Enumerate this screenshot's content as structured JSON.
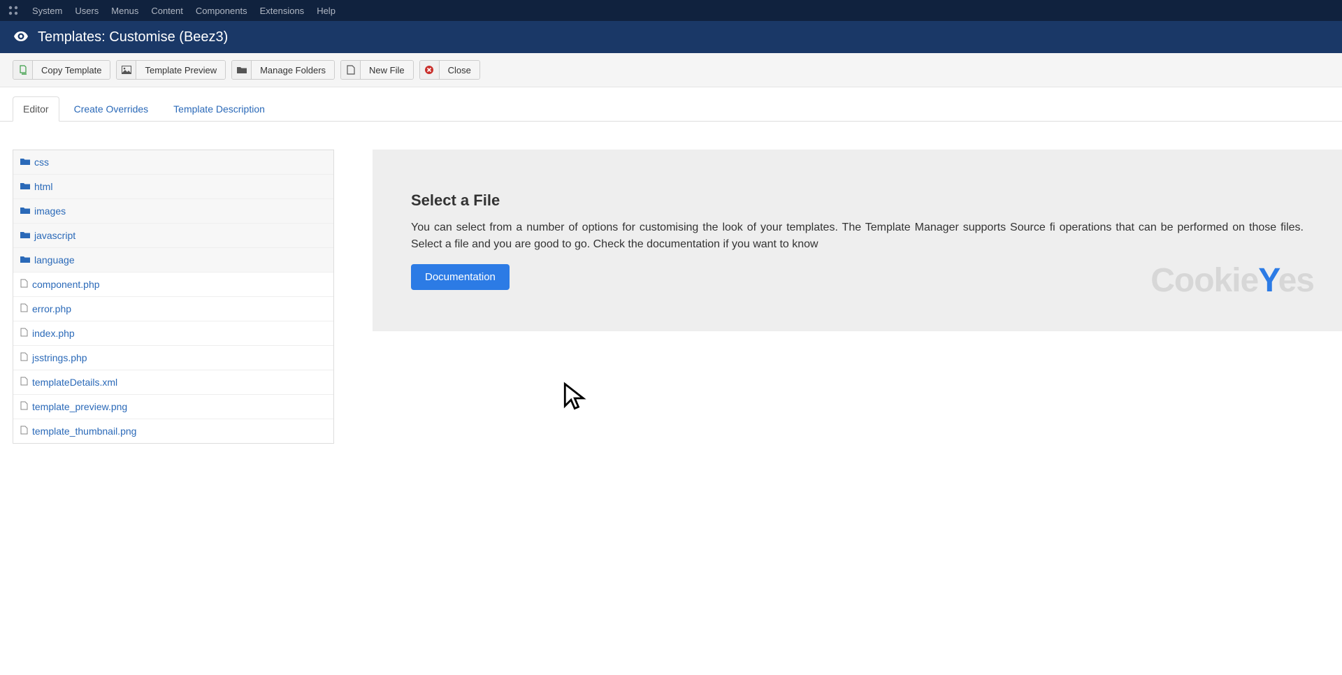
{
  "topnav": {
    "items": [
      "System",
      "Users",
      "Menus",
      "Content",
      "Components",
      "Extensions",
      "Help"
    ]
  },
  "titlebar": {
    "title": "Templates: Customise (Beez3)"
  },
  "toolbar": {
    "copy": "Copy Template",
    "preview": "Template Preview",
    "folders": "Manage Folders",
    "newfile": "New File",
    "close": "Close"
  },
  "tabs": {
    "editor": "Editor",
    "overrides": "Create Overrides",
    "description": "Template Description"
  },
  "filetree": {
    "folders": [
      "css",
      "html",
      "images",
      "javascript",
      "language"
    ],
    "files": [
      "component.php",
      "error.php",
      "index.php",
      "jsstrings.php",
      "templateDetails.xml",
      "template_preview.png",
      "template_thumbnail.png"
    ]
  },
  "panel": {
    "heading": "Select a File",
    "body": "You can select from a number of options for customising the look of your templates. The Template Manager supports Source fi operations that can be performed on those files. Select a file and you are good to go. Check the documentation if you want to know",
    "button": "Documentation"
  },
  "watermark": {
    "text_pre": "Cookie",
    "text_post": "es"
  }
}
